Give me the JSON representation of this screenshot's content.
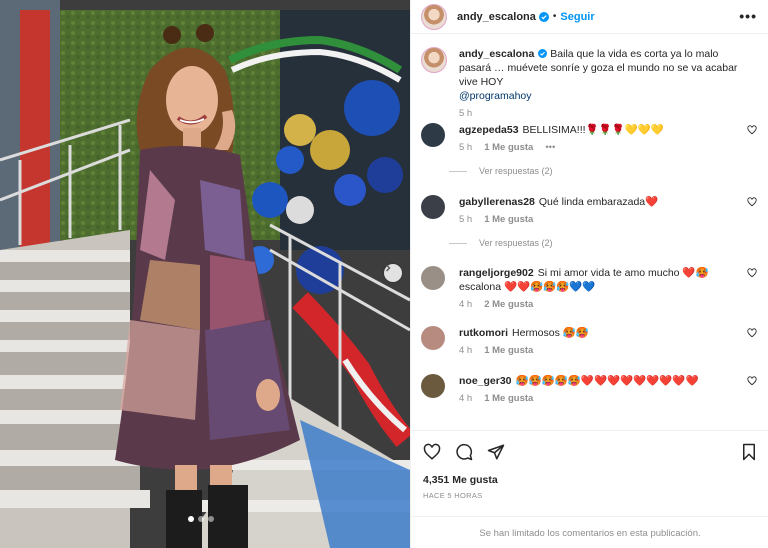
{
  "post": {
    "image_alt": "Woman in floral patchwork dress standing on stairs",
    "carousel_dots": 3,
    "active_dot": 1
  },
  "header": {
    "username": "andy_escalona",
    "separator": "•",
    "follow_label": "Seguir",
    "more_label": "•••"
  },
  "caption": {
    "username": "andy_escalona",
    "text": "Baila que la vida es corta ya lo malo pasará … muévete sonríe y goza el mundo no se va acabar vive HOY",
    "mention": "@programahoy",
    "time": "5 h"
  },
  "comments": [
    {
      "username": "agzepeda53",
      "text": "BELLISIMA!!!🌹🌹🌹💛💛💛",
      "time": "5 h",
      "likes": "1 Me gusta",
      "extra": "•••",
      "replies": "Ver respuestas (2)",
      "avatar_color": "#2e3a46"
    },
    {
      "username": "gabyllerenas28",
      "text": "Qué linda embarazada❤️",
      "time": "5 h",
      "likes": "1 Me gusta",
      "replies": "Ver respuestas (2)",
      "avatar_color": "#3a3f48"
    },
    {
      "username": "rangeljorge902",
      "text": "Si mi amor vida te amo mucho ❤️🥵 escalona ❤️❤️🥵🥵🥵💙💙",
      "time": "4 h",
      "likes": "2 Me gusta",
      "avatar_color": "#9a8f86"
    },
    {
      "username": "rutkomori",
      "text": "Hermosos 🥵🥵",
      "time": "4 h",
      "likes": "1 Me gusta",
      "avatar_color": "#b78b80"
    },
    {
      "username": "noe_ger30",
      "text": "🥵🥵🥵🥵🥵❤️❤️❤️❤️❤️❤️❤️❤️❤️",
      "time": "4 h",
      "likes": "1 Me gusta",
      "avatar_color": "#6b5a3e"
    }
  ],
  "footer": {
    "likes_count": "4,351 Me gusta",
    "time_ago": "HACE 5 HORAS",
    "comments_limited": "Se han limitado los comentarios en esta publicación."
  },
  "colors": {
    "accent": "#0095f6",
    "verified": "#0095f6",
    "muted": "#8e8e8e",
    "text": "#262626",
    "mention": "#00376b"
  },
  "icons": [
    "verified-badge-icon",
    "more-options-icon",
    "heart-icon",
    "comment-icon",
    "share-icon",
    "bookmark-icon",
    "chevron-right-icon"
  ]
}
